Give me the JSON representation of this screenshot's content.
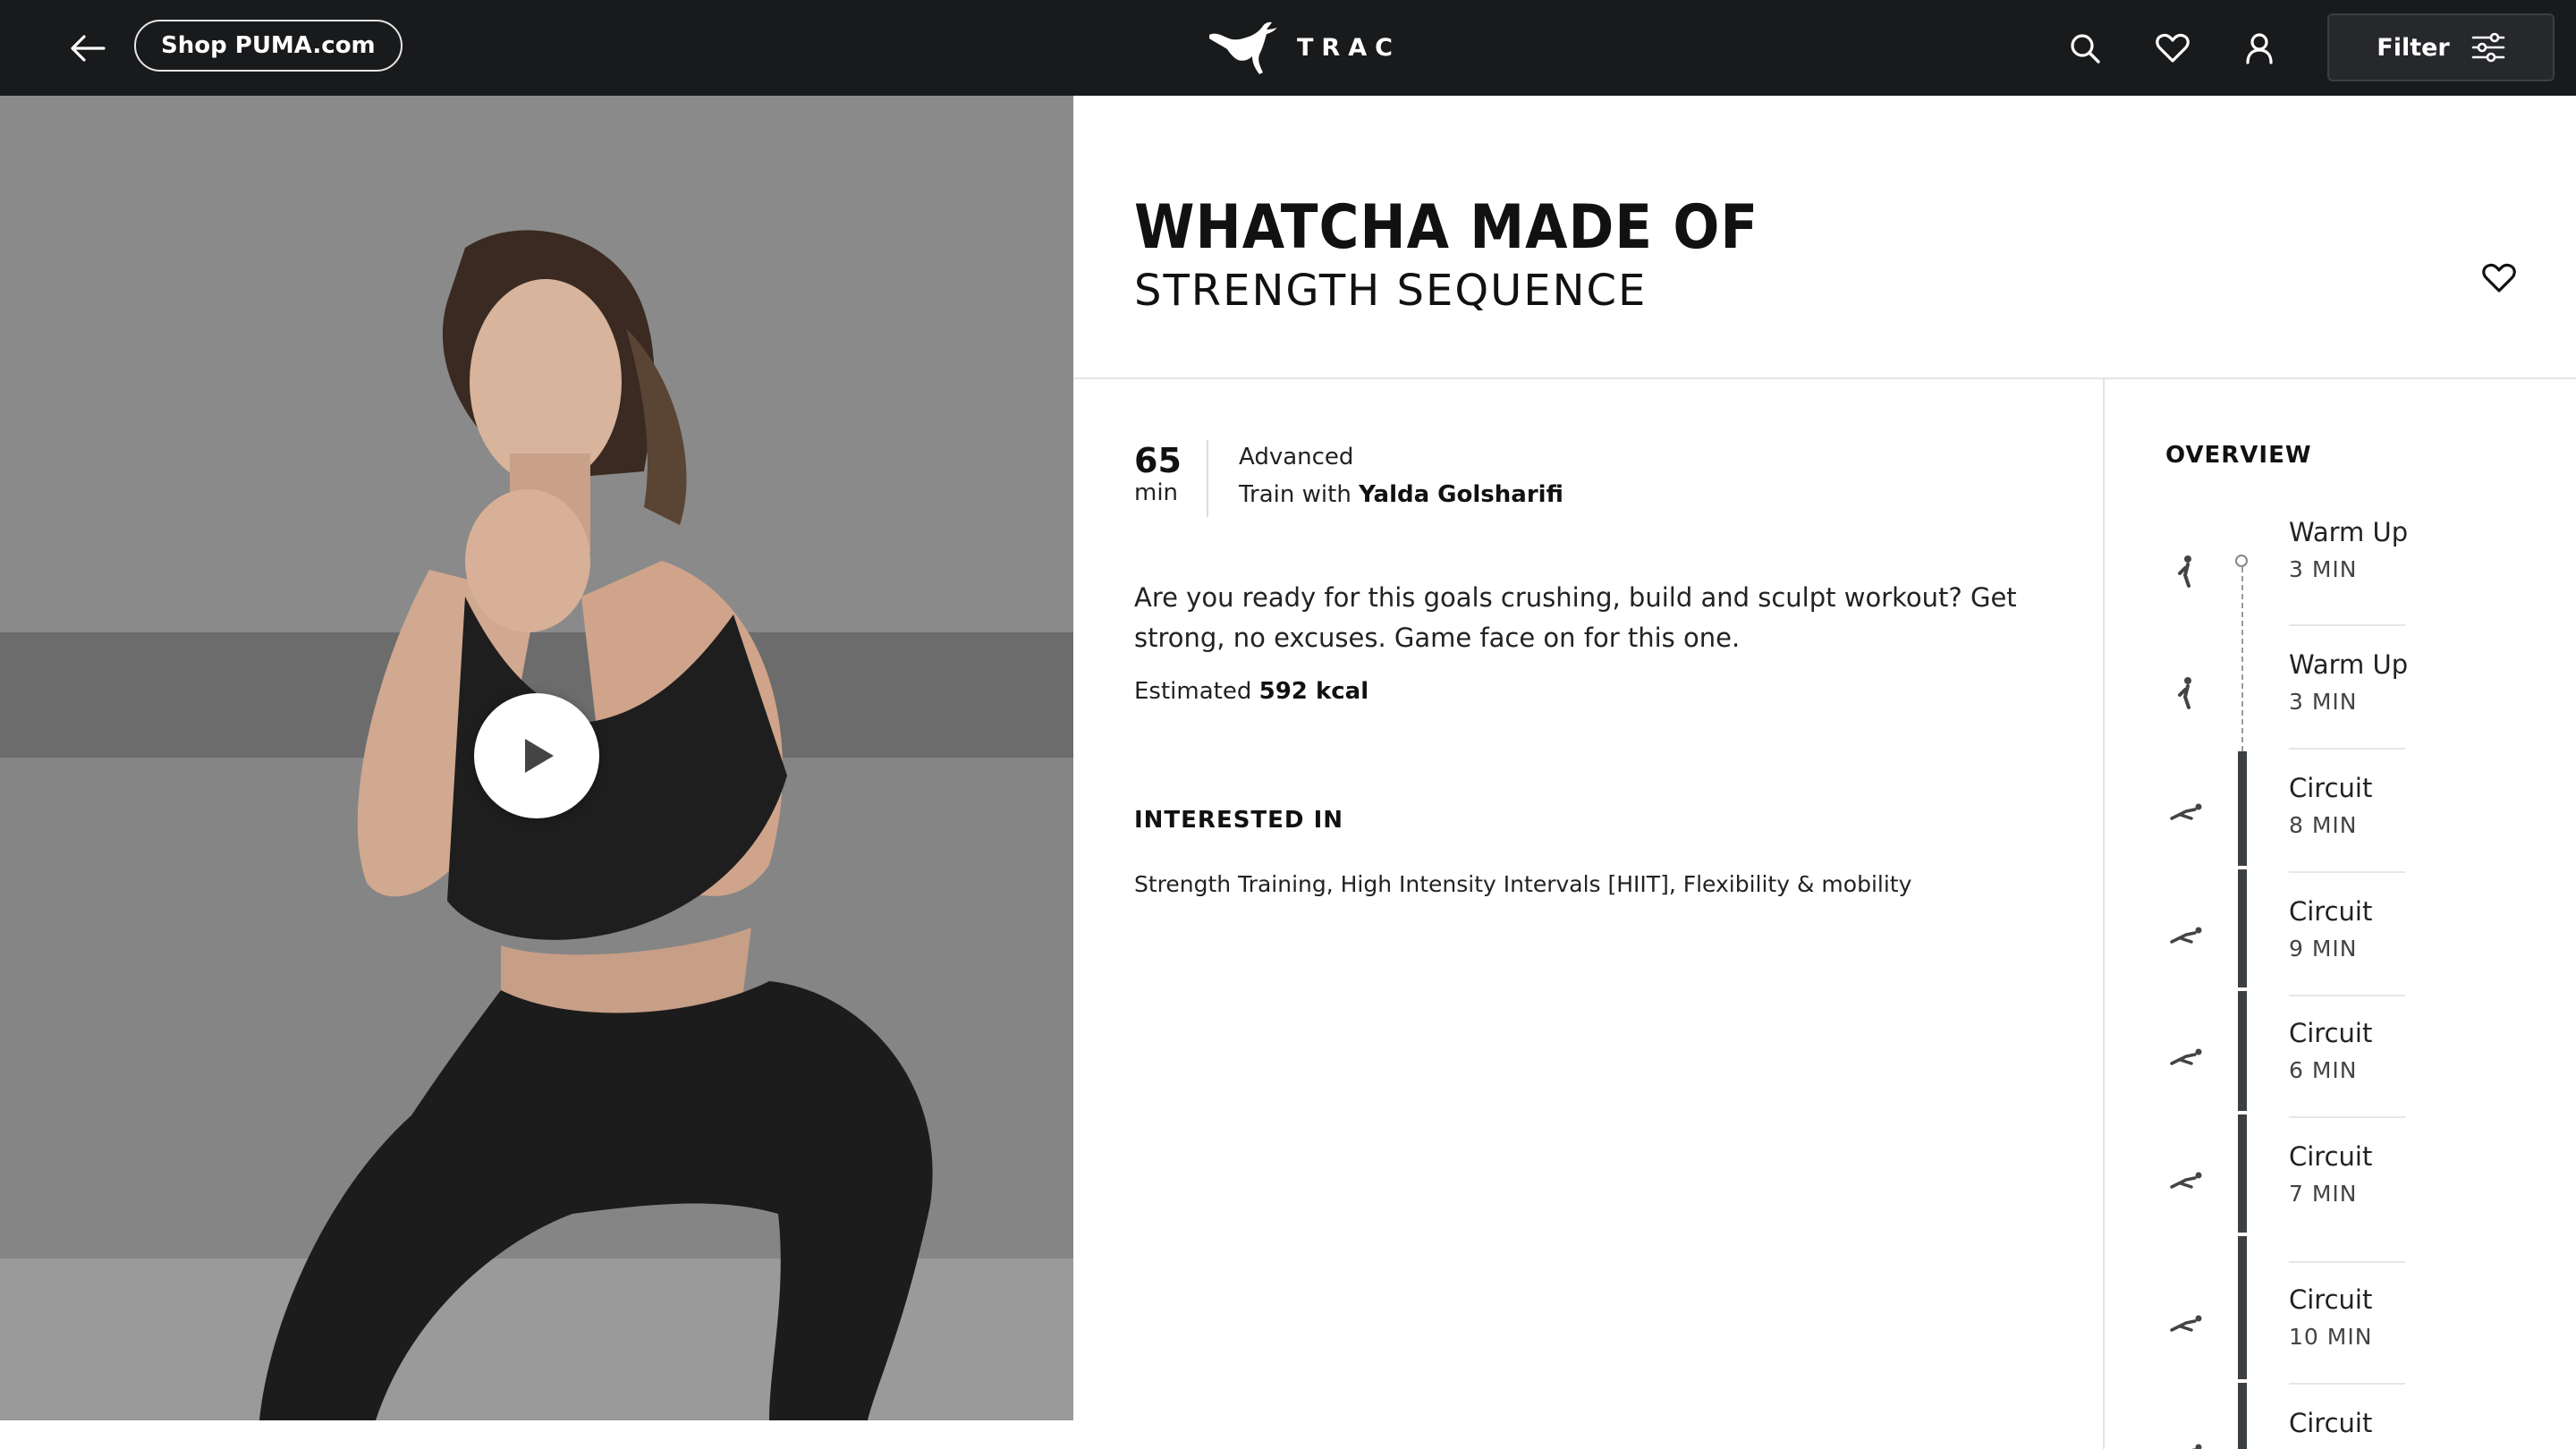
{
  "topbar": {
    "shop_label": "Shop PUMA.com",
    "brand_text": "TRAC",
    "filter_label": "Filter"
  },
  "workout": {
    "title": "WHATCHA MADE OF",
    "subtitle": "STRENGTH SEQUENCE",
    "duration_value": "65",
    "duration_unit": "min",
    "level": "Advanced",
    "trainer_prefix": "Train with",
    "trainer_name": "Yalda Golsharifi",
    "description": "Are you ready for this goals crushing, build and sculpt workout? Get strong, no excuses. Game face on for this one.",
    "estimate_prefix": "Estimated",
    "estimate_value": "592 kcal",
    "interested_heading": "INTERESTED IN",
    "interested_list": "Strength Training, High Intensity Intervals [HIIT], Flexibility & mobility"
  },
  "overview": {
    "heading": "OVERVIEW",
    "segments": [
      {
        "name": "Warm Up",
        "time": "3 MIN",
        "icon": "warm-up-figure-icon"
      },
      {
        "name": "Warm Up",
        "time": "3 MIN",
        "icon": "warm-up-figure-icon"
      },
      {
        "name": "Circuit",
        "time": "8 MIN",
        "icon": "circuit-figure-icon"
      },
      {
        "name": "Circuit",
        "time": "9 MIN",
        "icon": "circuit-figure-icon"
      },
      {
        "name": "Circuit",
        "time": "6 MIN",
        "icon": "circuit-figure-icon"
      },
      {
        "name": "Circuit",
        "time": "7 MIN",
        "icon": "circuit-figure-icon"
      },
      {
        "name": "Circuit",
        "time": "10 MIN",
        "icon": "circuit-figure-icon"
      },
      {
        "name": "Circuit",
        "time": "",
        "icon": "circuit-figure-icon"
      }
    ]
  },
  "icons": {
    "back": "arrow-left-icon",
    "search": "search-icon",
    "favorites": "heart-icon",
    "account": "user-icon",
    "filter": "sliders-icon",
    "play": "play-icon",
    "favorite_workout": "heart-outline-icon"
  },
  "colors": {
    "topbar_bg": "#191a1c",
    "filter_bg": "#26282b",
    "rail": "#3d4043",
    "text": "#111111"
  }
}
